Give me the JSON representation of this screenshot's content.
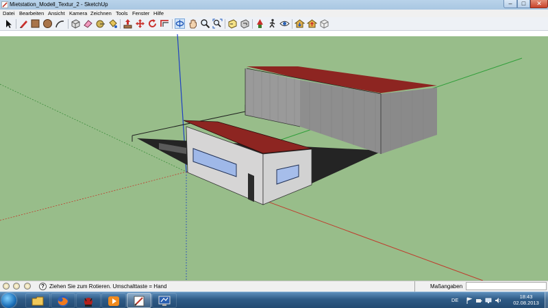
{
  "window": {
    "title": "Mietstation_Modell_Textur_2 - SketchUp",
    "controls": {
      "minimize": "–",
      "maximize": "□",
      "close": "✕"
    }
  },
  "menu": {
    "items": [
      {
        "label": "Datei"
      },
      {
        "label": "Bearbeiten"
      },
      {
        "label": "Ansicht"
      },
      {
        "label": "Kamera"
      },
      {
        "label": "Zeichnen"
      },
      {
        "label": "Tools"
      },
      {
        "label": "Fenster"
      },
      {
        "label": "Hilfe"
      }
    ]
  },
  "toolbar": {
    "tools": [
      {
        "name": "select-tool",
        "icon": "arrow-cursor-icon"
      },
      {
        "name": "line-tool",
        "icon": "pencil-icon"
      },
      {
        "name": "rectangle-tool",
        "icon": "rectangle-icon"
      },
      {
        "name": "circle-tool",
        "icon": "circle-icon"
      },
      {
        "name": "arc-tool",
        "icon": "arc-icon"
      },
      {
        "name": "make-component-tool",
        "icon": "component-icon"
      },
      {
        "name": "eraser-tool",
        "icon": "eraser-icon"
      },
      {
        "name": "tape-measure-tool",
        "icon": "tape-measure-icon"
      },
      {
        "name": "paint-bucket-tool",
        "icon": "paint-bucket-icon"
      },
      {
        "name": "push-pull-tool",
        "icon": "push-pull-icon"
      },
      {
        "name": "move-tool",
        "icon": "move-icon"
      },
      {
        "name": "rotate-tool",
        "icon": "rotate-icon"
      },
      {
        "name": "offset-tool",
        "icon": "offset-icon"
      },
      {
        "name": "orbit-tool",
        "icon": "orbit-icon"
      },
      {
        "name": "pan-tool",
        "icon": "hand-icon"
      },
      {
        "name": "zoom-tool",
        "icon": "magnifier-icon"
      },
      {
        "name": "zoom-extents-tool",
        "icon": "zoom-extents-icon"
      },
      {
        "name": "previous-view-tool",
        "icon": "previous-view-icon"
      },
      {
        "name": "next-view-tool",
        "icon": "next-view-icon"
      },
      {
        "name": "position-camera-tool",
        "icon": "position-camera-icon"
      },
      {
        "name": "walk-tool",
        "icon": "walk-icon"
      },
      {
        "name": "look-around-tool",
        "icon": "eye-icon"
      },
      {
        "name": "get-models-tool",
        "icon": "house-download-icon"
      },
      {
        "name": "share-model-tool",
        "icon": "house-share-icon"
      },
      {
        "name": "share-component-tool",
        "icon": "component-share-icon"
      }
    ]
  },
  "colors": {
    "sky": "#ffffff",
    "ground": "#98bd8a",
    "roof": "#8d2521",
    "wall": "#d6d5d5",
    "window_glass": "#9fb8e8",
    "x_axis": "#c0392b",
    "y_axis": "#2f9e3a",
    "z_axis": "#1d3fc4"
  },
  "statusbar": {
    "message": "Ziehen Sie zum Rotieren.  Umschalttaste = Hand",
    "help_glyph": "?",
    "measurements_label": "Maßangaben",
    "measurements_value": ""
  },
  "taskbar": {
    "apps": [
      {
        "name": "windows-explorer",
        "icon": "folder-icon",
        "state": "pinned"
      },
      {
        "name": "firefox",
        "icon": "firefox-icon",
        "state": "pinned"
      },
      {
        "name": "unknown-app",
        "icon": "red-creature-icon",
        "state": "pinned"
      },
      {
        "name": "media-player",
        "icon": "media-player-icon",
        "state": "pinned"
      },
      {
        "name": "sketchup",
        "icon": "sketchup-icon",
        "state": "active"
      },
      {
        "name": "display-settings",
        "icon": "monitor-icon",
        "state": "pinned"
      }
    ],
    "language": "DE",
    "clock_time": "18:43",
    "clock_date": "02.08.2013"
  }
}
